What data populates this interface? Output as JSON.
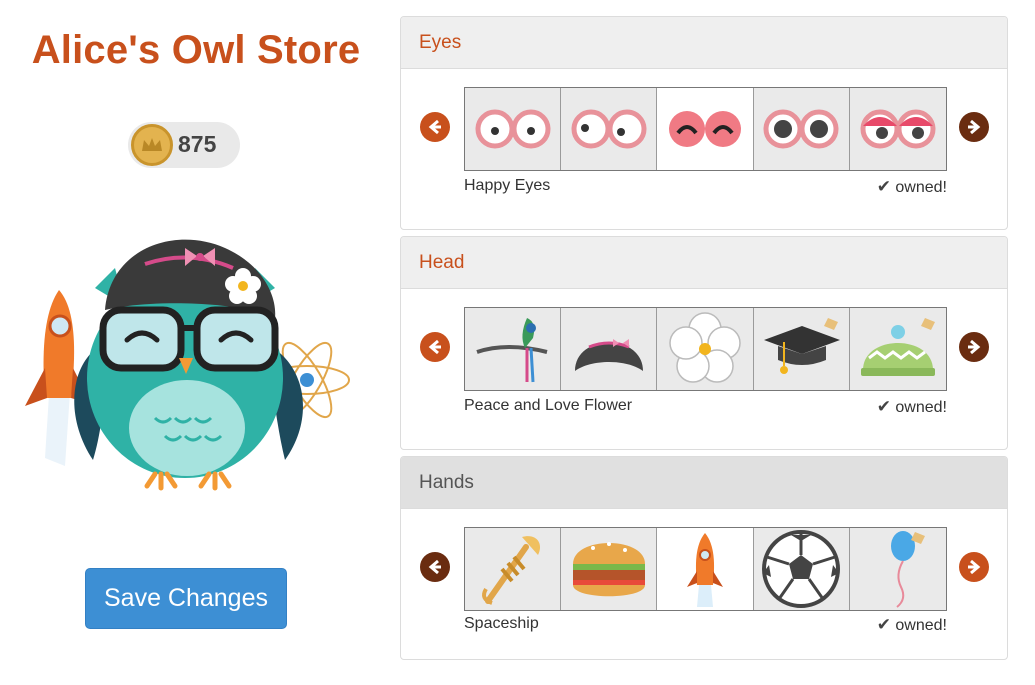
{
  "store": {
    "title": "Alice's Owl Store",
    "coins": "875",
    "save_label": "Save Changes"
  },
  "colors": {
    "accent": "#c8501c",
    "button": "#3d8fd4",
    "teal": "#2fb2a6"
  },
  "sections": [
    {
      "title": "Eyes",
      "selected_name": "Happy Eyes",
      "owned_label": "owned!",
      "items": [
        "round-eyes-icon",
        "side-glance-eyes-icon",
        "happy-eyes-icon",
        "dark-pupil-eyes-icon",
        "sleepy-eyes-icon"
      ]
    },
    {
      "title": "Head",
      "selected_name": "Peace and Love Flower",
      "owned_label": "owned!",
      "items": [
        "feather-headband-icon",
        "bow-hair-icon",
        "flower-icon",
        "graduation-cap-icon",
        "knit-hat-icon"
      ]
    },
    {
      "title": "Hands",
      "selected_name": "Spaceship",
      "owned_label": "owned!",
      "items": [
        "trumpet-icon",
        "sandwich-icon",
        "spaceship-icon",
        "soccer-ball-icon",
        "balloon-icon"
      ]
    }
  ]
}
